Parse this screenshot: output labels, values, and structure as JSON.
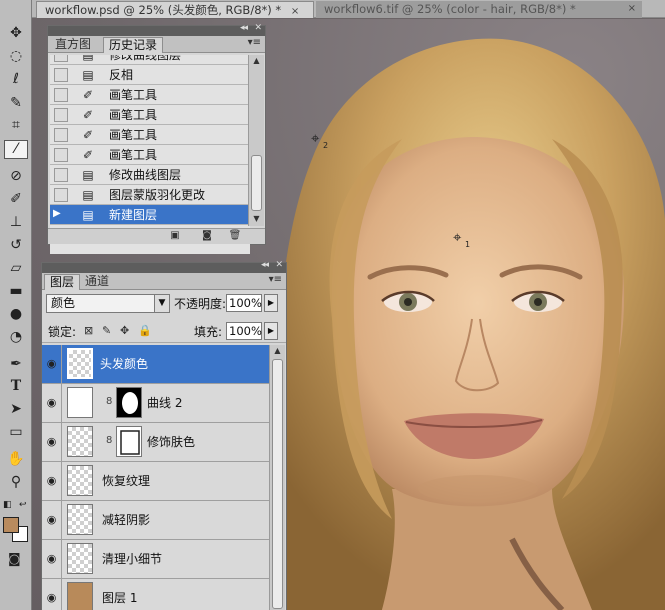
{
  "colors": {
    "accent": "#3a74c8",
    "foreground_swatch": "#b98b5e",
    "background_swatch": "#ffffff"
  },
  "document_tabs": [
    {
      "label": "workflow.psd @ 25% (头发颜色, RGB/8*) *",
      "close": "×",
      "active": true
    },
    {
      "label": "workflow6.tif @ 25% (color - hair, RGB/8*) *",
      "close": "×",
      "active": false
    }
  ],
  "toolbar": {
    "tools": [
      {
        "name": "move-tool",
        "icon": "move-icon"
      },
      {
        "name": "marquee-tool",
        "icon": "marquee-icon"
      },
      {
        "name": "lasso-tool",
        "icon": "lasso-icon"
      },
      {
        "name": "quick-select-tool",
        "icon": "quick-select-icon"
      },
      {
        "name": "crop-tool",
        "icon": "crop-icon"
      },
      {
        "name": "eyedropper-tool",
        "icon": "eyedropper-icon",
        "active": true
      },
      {
        "name": "healing-brush-tool",
        "icon": "bandage-icon"
      },
      {
        "name": "brush-tool",
        "icon": "brush-icon"
      },
      {
        "name": "clone-stamp-tool",
        "icon": "stamp-icon"
      },
      {
        "name": "history-brush-tool",
        "icon": "history-brush-icon"
      },
      {
        "name": "eraser-tool",
        "icon": "eraser-icon"
      },
      {
        "name": "gradient-tool",
        "icon": "gradient-icon"
      },
      {
        "name": "blur-tool",
        "icon": "blur-icon"
      },
      {
        "name": "dodge-tool",
        "icon": "dodge-icon"
      },
      {
        "name": "pen-tool",
        "icon": "pen-icon"
      },
      {
        "name": "type-tool",
        "icon": "type-icon"
      },
      {
        "name": "path-select-tool",
        "icon": "arrow-icon"
      },
      {
        "name": "shape-tool",
        "icon": "rectangle-icon"
      },
      {
        "name": "hand-tool",
        "icon": "hand-icon"
      },
      {
        "name": "zoom-tool",
        "icon": "zoom-icon"
      }
    ],
    "type_tool_glyph": "T"
  },
  "history": {
    "tabs": [
      {
        "label": "直方图"
      },
      {
        "label": "历史记录"
      }
    ],
    "items": [
      {
        "label": "修改曲线图层",
        "icon": "document-icon"
      },
      {
        "label": "反相",
        "icon": "document-icon"
      },
      {
        "label": "画笔工具",
        "icon": "brush-icon"
      },
      {
        "label": "画笔工具",
        "icon": "brush-icon"
      },
      {
        "label": "画笔工具",
        "icon": "brush-icon"
      },
      {
        "label": "画笔工具",
        "icon": "brush-icon"
      },
      {
        "label": "修改曲线图层",
        "icon": "document-icon"
      },
      {
        "label": "图层蒙版羽化更改",
        "icon": "document-icon"
      },
      {
        "label": "新建图层",
        "icon": "document-icon",
        "selected": true
      }
    ]
  },
  "layers": {
    "tabs": [
      {
        "label": "图层"
      },
      {
        "label": "通道"
      }
    ],
    "blend_mode": "颜色",
    "opacity_label": "不透明度:",
    "opacity_value": "100%",
    "lock_label": "锁定:",
    "fill_label": "填充:",
    "fill_value": "100%",
    "items": [
      {
        "name": "头发颜色",
        "selected": true
      },
      {
        "name": "曲线 2",
        "has_mask": true
      },
      {
        "name": "修饰肤色",
        "has_mask": true
      },
      {
        "name": "恢复纹理"
      },
      {
        "name": "减轻阴影"
      },
      {
        "name": "清理小细节"
      },
      {
        "name": "图层 1"
      }
    ]
  },
  "canvas": {
    "cursor_labels": [
      "2",
      "1"
    ]
  }
}
